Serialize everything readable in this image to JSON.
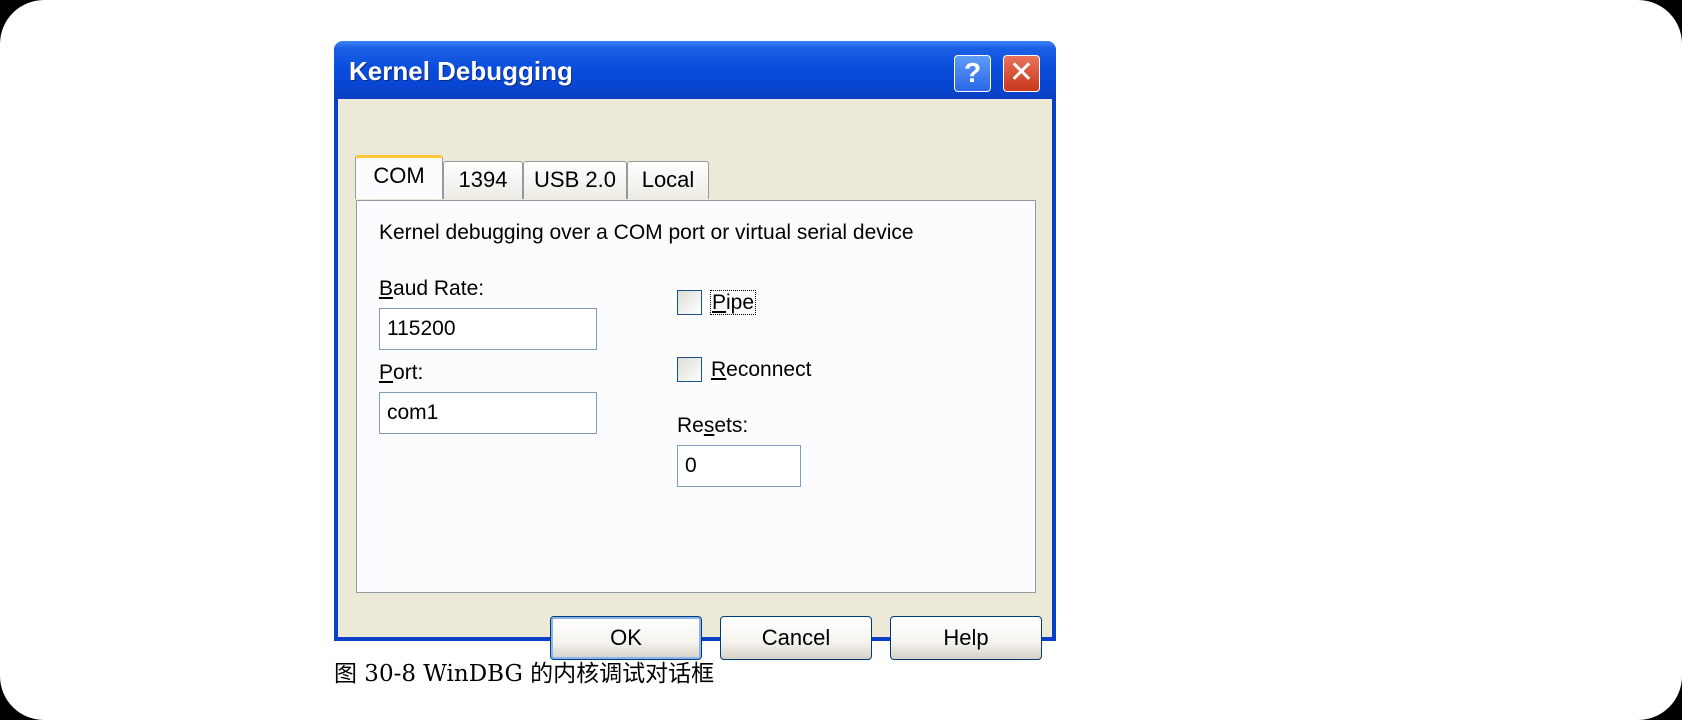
{
  "window": {
    "title": "Kernel Debugging",
    "help_button": "?",
    "close_button": "✕"
  },
  "tabs": [
    {
      "label": "COM",
      "active": true
    },
    {
      "label": "1394",
      "active": false
    },
    {
      "label": "USB 2.0",
      "active": false
    },
    {
      "label": "Local",
      "active": false
    }
  ],
  "com_tab": {
    "description": "Kernel debugging over a COM port or virtual serial device",
    "baud_rate": {
      "label": "Baud Rate:",
      "value": "115200"
    },
    "port": {
      "label": "Port:",
      "value": "com1"
    },
    "pipe": {
      "label": "Pipe",
      "checked": false
    },
    "reconnect": {
      "label": "Reconnect",
      "checked": false
    },
    "resets": {
      "label": "Resets:",
      "value": "0"
    }
  },
  "buttons": {
    "ok": "OK",
    "cancel": "Cancel",
    "help": "Help"
  },
  "figure_caption": "图 30-8 WinDBG 的内核调试对话框",
  "colors": {
    "titlebar": "#0a4edc",
    "dialog_face": "#ece9d8",
    "active_tab_highlight": "#ffc83c",
    "close_button": "#c9371b"
  },
  "icons": {
    "help": "question-mark-icon",
    "close": "close-x-icon"
  }
}
